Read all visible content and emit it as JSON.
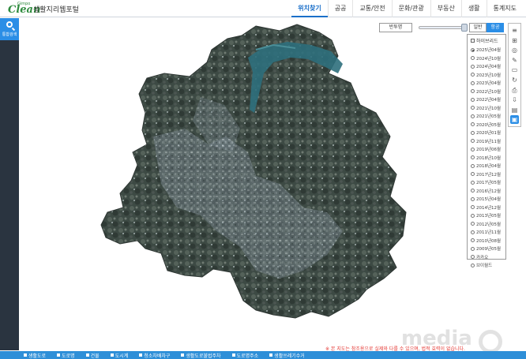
{
  "app": {
    "logo_text": "Clean",
    "logo_super": "Gimpo",
    "portal_title": "생활지리웹포털"
  },
  "nav": {
    "items": [
      {
        "label": "위치찾기",
        "active": true
      },
      {
        "label": "공공",
        "active": false
      },
      {
        "label": "교통/안전",
        "active": false
      },
      {
        "label": "문화/관광",
        "active": false
      },
      {
        "label": "부동산",
        "active": false
      },
      {
        "label": "생활",
        "active": false
      },
      {
        "label": "통계지도",
        "active": false
      }
    ]
  },
  "sidebar": {
    "search_label": "통합검색"
  },
  "map_controls": {
    "transparency_label": "반투명",
    "slider_value_percent": 95,
    "normal_label": "일반",
    "satellite_label": "항공",
    "selected_mode": "항공"
  },
  "toolbar": {
    "tools": [
      "layers-icon",
      "grid-icon",
      "compass-icon",
      "pencil-icon",
      "rectangle-icon",
      "refresh-icon",
      "print-icon",
      "download-icon",
      "save-icon",
      "book-icon"
    ],
    "active_tool": "book-icon"
  },
  "year_panel": {
    "hybrid_label": "하이브리드",
    "hybrid_checked": false,
    "years": [
      {
        "label": "2025년04월",
        "selected": true
      },
      {
        "label": "2024년10월",
        "selected": false
      },
      {
        "label": "2024년04월",
        "selected": false
      },
      {
        "label": "2023년10월",
        "selected": false
      },
      {
        "label": "2023년04월",
        "selected": false
      },
      {
        "label": "2022년10월",
        "selected": false
      },
      {
        "label": "2022년04월",
        "selected": false
      },
      {
        "label": "2021년10월",
        "selected": false
      },
      {
        "label": "2021년05월",
        "selected": false
      },
      {
        "label": "2020년05월",
        "selected": false
      },
      {
        "label": "2020년01월",
        "selected": false
      },
      {
        "label": "2019년11월",
        "selected": false
      },
      {
        "label": "2019년06월",
        "selected": false
      },
      {
        "label": "2018년10월",
        "selected": false
      },
      {
        "label": "2018년04월",
        "selected": false
      },
      {
        "label": "2017년12월",
        "selected": false
      },
      {
        "label": "2017년05월",
        "selected": false
      },
      {
        "label": "2016년12월",
        "selected": false
      },
      {
        "label": "2015년04월",
        "selected": false
      },
      {
        "label": "2014년12월",
        "selected": false
      },
      {
        "label": "2013년05월",
        "selected": false
      },
      {
        "label": "2012년05월",
        "selected": false
      },
      {
        "label": "2011년11월",
        "selected": false
      },
      {
        "label": "2010년08월",
        "selected": false
      },
      {
        "label": "2009년05월",
        "selected": false
      },
      {
        "label": "카카오",
        "selected": false
      },
      {
        "label": "브이월드",
        "selected": false
      }
    ]
  },
  "notice": "※ 본 지도는 참조용으로 실제와 다를 수 있으며, 법적 효력이 없습니다.",
  "bottom_bar": {
    "items": [
      "생활도로",
      "도로명",
      "건물",
      "도시계",
      "청소차배차구",
      "생활도로불법주차",
      "도로명주소",
      "생활쓰레기수거"
    ]
  },
  "watermark": "media"
}
